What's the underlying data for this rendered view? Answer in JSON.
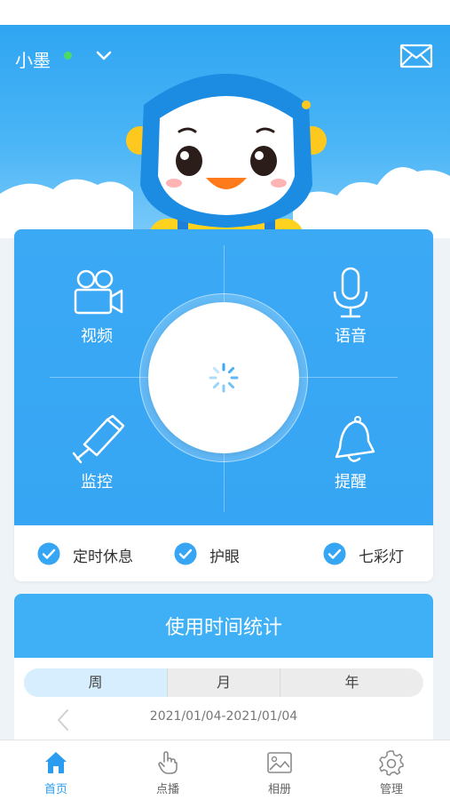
{
  "header": {
    "user_name": "小墨",
    "online_color": "#4cd964",
    "dropdown_icon": "chevron-down-icon",
    "mail_icon": "mail-icon"
  },
  "functions": {
    "video_label": "视频",
    "voice_label": "语音",
    "monitor_label": "监控",
    "reminder_label": "提醒",
    "center_state": "loading"
  },
  "toggles": [
    {
      "label": "定时休息",
      "checked": true
    },
    {
      "label": "护眼",
      "checked": true
    },
    {
      "label": "七彩灯",
      "checked": true
    }
  ],
  "stats": {
    "title": "使用时间统计",
    "tabs": [
      "周",
      "月",
      "年"
    ],
    "active_tab": "周",
    "date_range": "2021/01/04-2021/01/04"
  },
  "tabbar": [
    {
      "label": "首页",
      "icon": "home-icon",
      "active": true
    },
    {
      "label": "点播",
      "icon": "tap-hand-icon",
      "active": false
    },
    {
      "label": "相册",
      "icon": "photo-album-icon",
      "active": false
    },
    {
      "label": "管理",
      "icon": "gear-icon",
      "active": false
    }
  ],
  "colors": {
    "accent": "#2a9df0",
    "primary_blue": "#3ba9f4",
    "check_blue": "#36a5f3"
  }
}
